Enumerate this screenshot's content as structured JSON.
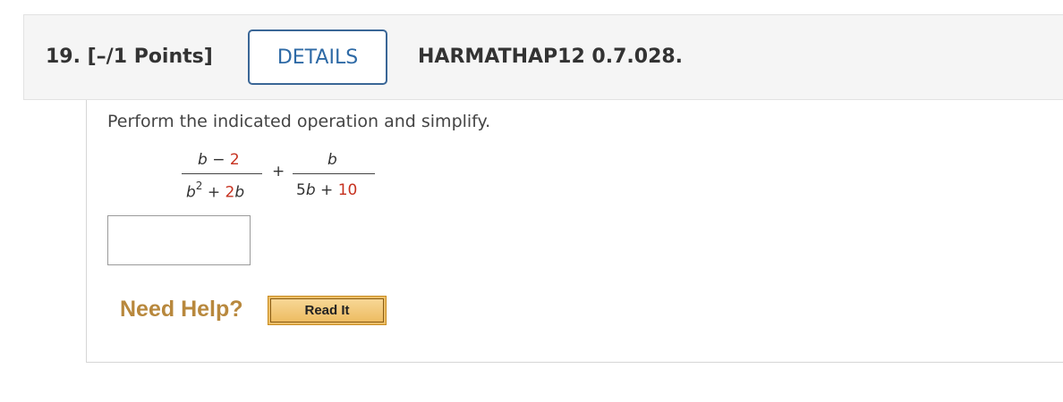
{
  "question": {
    "number_points": "19.  [–/1 Points]",
    "details_label": "DETAILS",
    "code": "HARMATHAP12 0.7.028."
  },
  "problem": {
    "prompt": "Perform the indicated operation and simplify.",
    "fraction1": {
      "num_var": "b",
      "num_op": "−",
      "num_const": "2",
      "den_var": "b",
      "den_exp": "2",
      "den_op": "+",
      "den_coef": "2",
      "den_var2": "b"
    },
    "operator": "+",
    "fraction2": {
      "num_var": "b",
      "den_coef": "5",
      "den_var": "b",
      "den_op": "+",
      "den_const": "10"
    }
  },
  "answer": {
    "value": ""
  },
  "help": {
    "label": "Need Help?",
    "read_it": "Read It"
  }
}
